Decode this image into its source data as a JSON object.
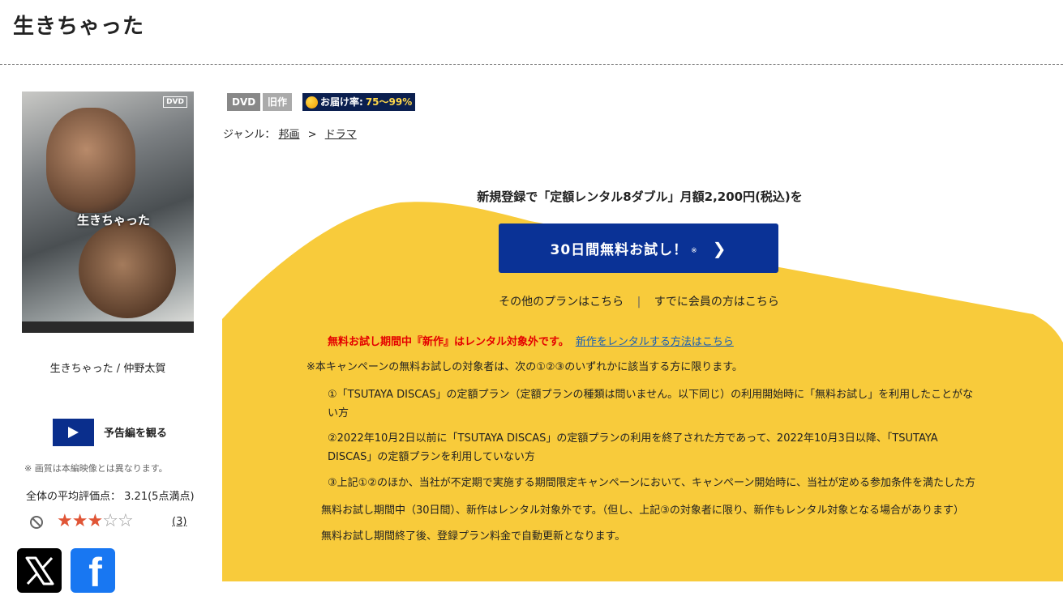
{
  "page": {
    "title": "生きちゃった"
  },
  "poster": {
    "logo": "DVD",
    "title_text": "生きちゃった"
  },
  "product": {
    "caption": "生きちゃった / 仲野太賀",
    "trailer_label": "予告編を観る",
    "quality_note": "※ 画質は本編映像とは異なります。",
    "rating_label": "全体の平均評価点：",
    "rating_value": "3.21(5点満点)",
    "rating_stars": 3,
    "rating_max": 5,
    "review_count": "(3)"
  },
  "icons": {
    "ban": "ban-icon",
    "play": "play-icon",
    "x_share": "x-logo-icon",
    "facebook_share": "facebook-logo-icon",
    "delivery": "orange-circle-icon",
    "chevron": "chevron-right-icon"
  },
  "badges": {
    "dvd": "DVD",
    "old": "旧作",
    "delivery_label": "お届け率:",
    "delivery_rate": "75〜99%"
  },
  "genre": {
    "label": "ジャンル：",
    "parent": "邦画",
    "separator": ">",
    "child": "ドラマ"
  },
  "promo": {
    "heading": "新規登録で「定額レンタル8ダブル」月額2,200円(税込)を",
    "cta_label": "30日間無料お試し！",
    "cta_mark": "※",
    "other_plans": "その他のプランはこちら",
    "divider": "|",
    "members": "すでに会員の方はこちら",
    "warning": "無料お試し期間中『新作』はレンタル対象外です。",
    "warning_link": "新作をレンタルする方法はこちら",
    "intro": "※本キャンペーンの無料お試しの対象者は、次の①②③のいずれかに該当する方に限ります。",
    "cond1": "①「TSUTAYA DISCAS」の定額プラン（定額プランの種類は問いません。以下同じ）の利用開始時に「無料お試し」を利用したことがない方",
    "cond2": "②2022年10月2日以前に「TSUTAYA DISCAS」の定額プランの利用を終了された方であって、2022年10月3日以降、「TSUTAYA DISCAS」の定額プランを利用していない方",
    "cond3": "③上記①②のほか、当社が不定期で実施する期間限定キャンペーンにおいて、キャンペーン開始時に、当社が定める参加条件を満たした方",
    "note1": "無料お試し期間中（30日間）、新作はレンタル対象外です。（但し、上記③の対象者に限り、新作もレンタル対象となる場合があります）",
    "note2": "無料お試し期間終了後、登録プラン料金で自動更新となります。"
  },
  "colors": {
    "promo_bg": "#f8cb3b",
    "cta_bg": "#0a3296",
    "warning_red": "#e40000",
    "star_on": "#e05536"
  }
}
